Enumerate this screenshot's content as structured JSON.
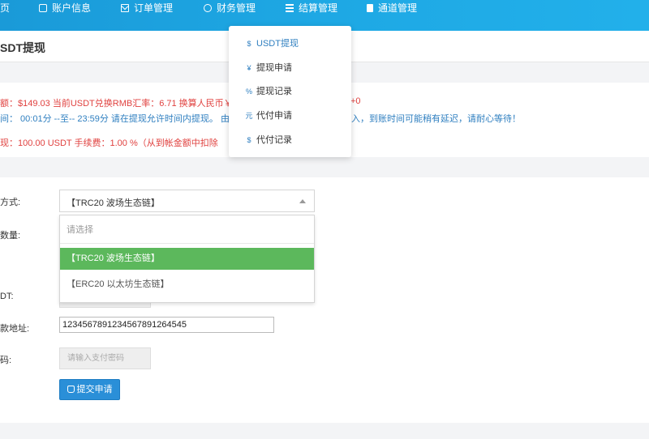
{
  "nav": {
    "home_label": "页",
    "items": [
      {
        "label": "账户信息",
        "icon": "user-icon"
      },
      {
        "label": "订单管理",
        "icon": "mail-icon"
      },
      {
        "label": "财务管理",
        "icon": "cube-icon"
      },
      {
        "label": "结算管理",
        "icon": "layers-icon"
      },
      {
        "label": "通道管理",
        "icon": "file-icon"
      }
    ]
  },
  "page": {
    "title": "SDT提现"
  },
  "info": {
    "line1_red": "额：$149.03  当前USDT兑换RMB汇率：6.71  换算人民币￥",
    "line1_tail": "+0",
    "line2_blue": "间： 00:01分 --至-- 23:59分 请在提现允许时间内提现。 由于",
    "line2_tail": "入，到账时间可能稍有延迟，请耐心等待！",
    "line3_red": "现：100.00 USDT      手续费：1.00 %（从到帐金额中扣除"
  },
  "settlement_menu": {
    "items": [
      {
        "label": "USDT提现",
        "icon_glyph": "$",
        "active": true
      },
      {
        "label": "提现申请",
        "icon_glyph": "¥",
        "active": false
      },
      {
        "label": "提现记录",
        "icon_glyph": "%",
        "active": false
      },
      {
        "label": "代付申请",
        "icon_glyph": "元",
        "active": false
      },
      {
        "label": "代付记录",
        "icon_glyph": "$",
        "active": false
      }
    ]
  },
  "form": {
    "method_label": "方式:",
    "method_value": "【TRC20 波场生态链】",
    "amount_label": "数量:",
    "usdt_label": "DT:",
    "address_label": "款地址:",
    "address_value": "12345678912345678912645​45",
    "password_label": "码:",
    "password_placeholder": "请输入支付密码",
    "submit_label": "提交申请",
    "options": [
      "请选择",
      "【TRC20 波场生态链】",
      "【ERC20 以太坊生态链】"
    ]
  },
  "colors": {
    "nav_bg": "#1ea8e4",
    "accent_blue": "#2a8fd8",
    "warning_red": "#e0413f",
    "selected_green": "#5cb85c"
  }
}
